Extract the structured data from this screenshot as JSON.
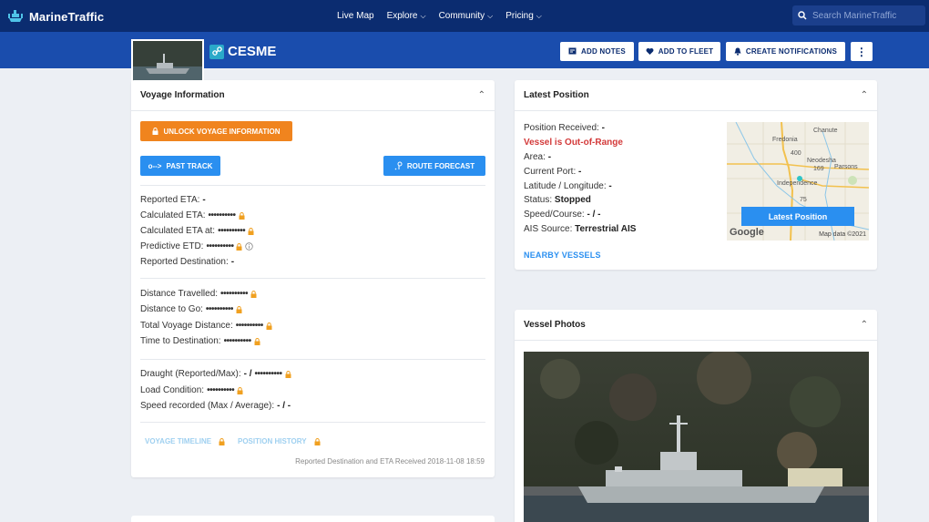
{
  "nav": {
    "brand": "MarineTraffic",
    "links": [
      {
        "label": "Live Map",
        "dropdown": false
      },
      {
        "label": "Explore",
        "dropdown": true
      },
      {
        "label": "Community",
        "dropdown": true
      },
      {
        "label": "Pricing",
        "dropdown": true
      }
    ],
    "search_placeholder": "Search MarineTraffic"
  },
  "vessel": {
    "name": "CESME"
  },
  "actions": {
    "add_notes": "ADD NOTES",
    "add_to_fleet": "ADD TO FLEET",
    "create_notifications": "CREATE NOTIFICATIONS",
    "more": "⋮"
  },
  "voyage": {
    "title": "Voyage Information",
    "unlock_label": "UNLOCK VOYAGE INFORMATION",
    "past_track_label": "PAST TRACK",
    "route_forecast_label": "ROUTE FORECAST",
    "masked": "••••••••••",
    "group1": {
      "reported_eta_label": "Reported ETA:",
      "reported_eta_value": "-",
      "calculated_eta_label": "Calculated ETA:",
      "calculated_eta_at_label": "Calculated ETA at:",
      "predictive_etd_label": "Predictive ETD:",
      "reported_destination_label": "Reported Destination:",
      "reported_destination_value": "-"
    },
    "group2": {
      "distance_travelled_label": "Distance Travelled:",
      "distance_to_go_label": "Distance to Go:",
      "total_voyage_distance_label": "Total Voyage Distance:",
      "time_to_destination_label": "Time to Destination:"
    },
    "group3": {
      "draught_label": "Draught (Reported/Max):",
      "draught_value": "- /",
      "load_condition_label": "Load Condition:",
      "speed_recorded_label": "Speed recorded (Max / Average):",
      "speed_recorded_value": "- / -"
    },
    "voyage_timeline_label": "VOYAGE TIMELINE",
    "position_history_label": "POSITION HISTORY",
    "footnote": "Reported Destination and ETA Received 2018-11-08 18:59"
  },
  "latest_position": {
    "title": "Latest Position",
    "position_received_label": "Position Received:",
    "position_received_value": "-",
    "out_of_range": "Vessel is Out-of-Range",
    "area_label": "Area:",
    "area_value": "-",
    "current_port_label": "Current Port:",
    "current_port_value": "-",
    "lat_lon_label": "Latitude / Longitude:",
    "lat_lon_value": "-",
    "status_label": "Status:",
    "status_value": "Stopped",
    "speed_course_label": "Speed/Course:",
    "speed_course_value": "- / -",
    "ais_source_label": "AIS Source:",
    "ais_source_value": "Terrestrial AIS",
    "nearby_label": "NEARBY VESSELS",
    "map": {
      "button_label": "Latest Position",
      "towns": [
        "Chanute",
        "Fredonia",
        "Neodesha",
        "Parsons",
        "Independence"
      ],
      "roads": [
        "400",
        "169",
        "75"
      ],
      "attribution": "Map data ©2021",
      "google": "Google"
    }
  },
  "photos": {
    "title": "Vessel Photos"
  },
  "colors": {
    "nav_bg": "#0b2c70",
    "band_bg": "#1a4dad",
    "accent_blue": "#2a8ff0",
    "unlock_orange": "#f0841e",
    "lock_orange": "#f0a020",
    "alert_red": "#d33a3a"
  }
}
